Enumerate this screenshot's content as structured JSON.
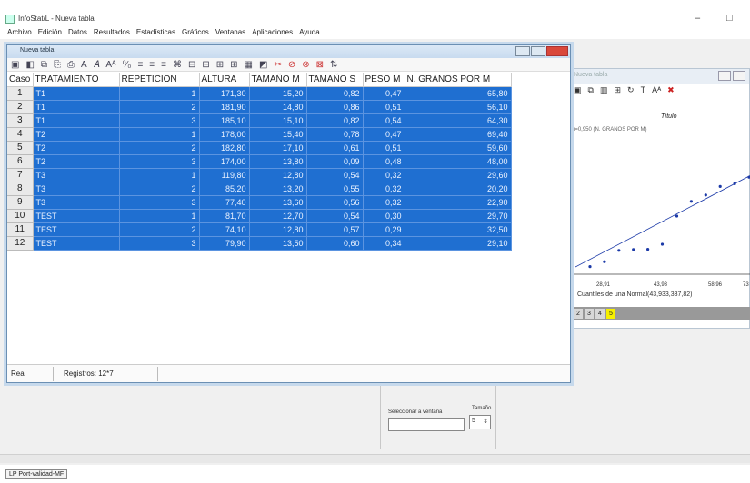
{
  "app": {
    "title": "InfoStat/L - Nueva tabla",
    "menu": [
      "Archivo",
      "Edición",
      "Datos",
      "Resultados",
      "Estadísticas",
      "Gráficos",
      "Ventanas",
      "Aplicaciones",
      "Ayuda"
    ],
    "window_controls": [
      "–",
      "□"
    ]
  },
  "table_window": {
    "title": "Nueva tabla",
    "columns": [
      "Caso",
      "TRATAMIENTO",
      "REPETICION",
      "ALTURA",
      "TAMAÑO M",
      "TAMAÑO S",
      "PESO M",
      "N. GRANOS POR M"
    ],
    "rows": [
      [
        "1",
        "T1",
        "1",
        "171,30",
        "15,20",
        "0,82",
        "0,47",
        "65,80"
      ],
      [
        "2",
        "T1",
        "2",
        "181,90",
        "14,80",
        "0,86",
        "0,51",
        "56,10"
      ],
      [
        "3",
        "T1",
        "3",
        "185,10",
        "15,10",
        "0,82",
        "0,54",
        "64,30"
      ],
      [
        "4",
        "T2",
        "1",
        "178,00",
        "15,40",
        "0,78",
        "0,47",
        "69,40"
      ],
      [
        "5",
        "T2",
        "2",
        "182,80",
        "17,10",
        "0,61",
        "0,51",
        "59,60"
      ],
      [
        "6",
        "T2",
        "3",
        "174,00",
        "13,80",
        "0,09",
        "0,48",
        "48,00"
      ],
      [
        "7",
        "T3",
        "1",
        "119,80",
        "12,80",
        "0,54",
        "0,32",
        "29,60"
      ],
      [
        "8",
        "T3",
        "2",
        "85,20",
        "13,20",
        "0,55",
        "0,32",
        "20,20"
      ],
      [
        "9",
        "T3",
        "3",
        "77,40",
        "13,60",
        "0,56",
        "0,32",
        "22,90"
      ],
      [
        "10",
        "TEST",
        "1",
        "81,70",
        "12,70",
        "0,54",
        "0,30",
        "29,70"
      ],
      [
        "11",
        "TEST",
        "2",
        "74,10",
        "12,80",
        "0,57",
        "0,29",
        "32,50"
      ],
      [
        "12",
        "TEST",
        "3",
        "79,90",
        "13,50",
        "0,60",
        "0,34",
        "29,10"
      ]
    ],
    "footer_mode": "Real",
    "footer_records": "Registros: 12*7"
  },
  "chart_window": {
    "title": "Nueva tabla",
    "chart_title": "Título",
    "legend": "n=0,950 (N. GRANOS POR M)",
    "xlabel": "Cuantiles de una Normal(43,933,337,82)",
    "xticks": [
      "28,91",
      "43,93",
      "58,96",
      "73"
    ],
    "tabs": [
      "2",
      "3",
      "4",
      "5"
    ],
    "active_tab": "5"
  },
  "lower_panel": {
    "select_label": "Seleccionar a ventana",
    "size_label": "Tamaño",
    "size_value": "5"
  },
  "statusbar": {
    "text": "LP Port-validad-MF"
  },
  "colors": {
    "selection": "#1f6fd1",
    "chart_points": "#1c3aa8"
  }
}
